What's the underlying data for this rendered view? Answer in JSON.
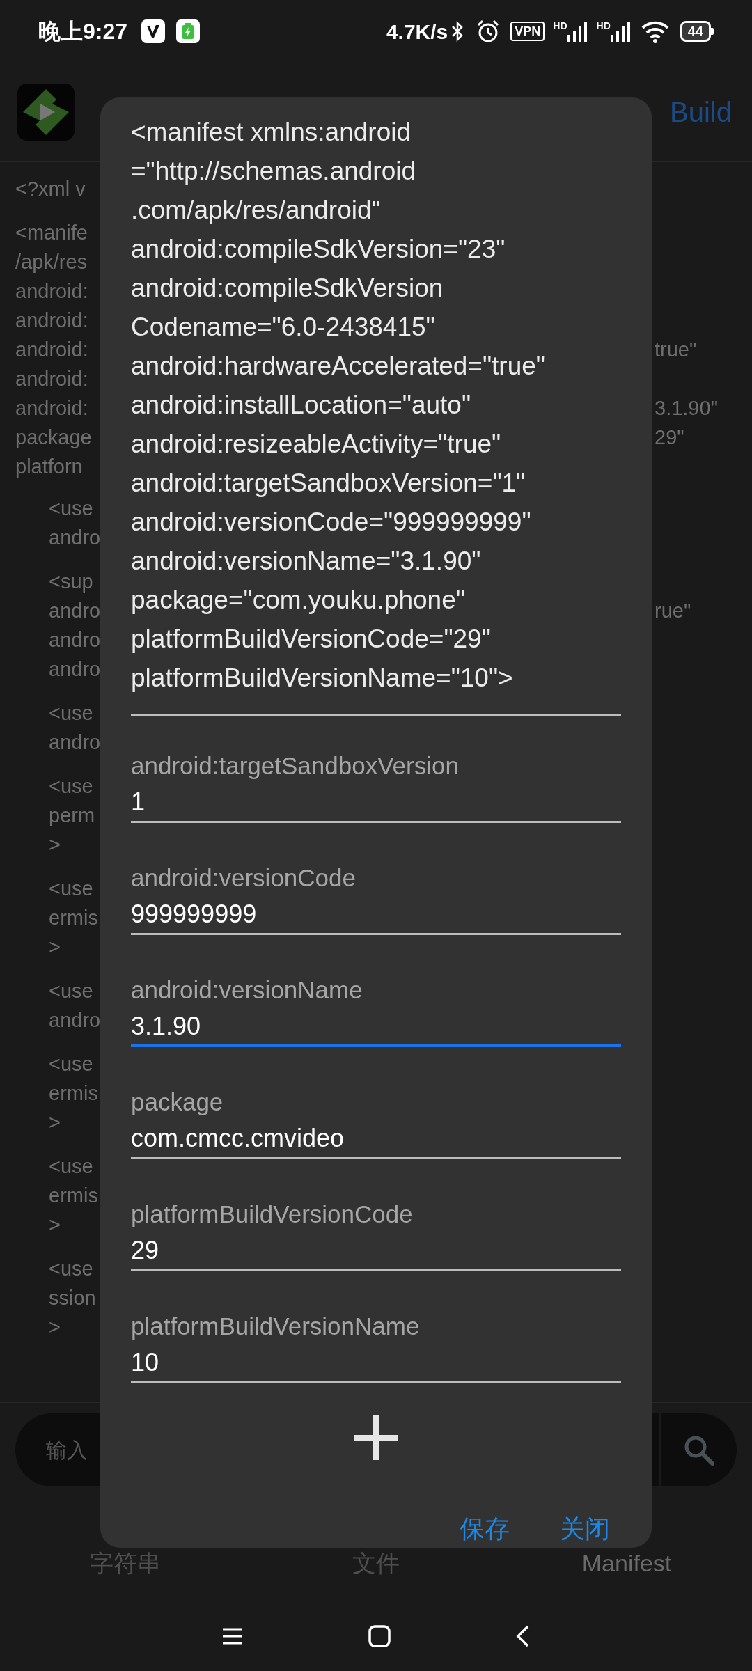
{
  "status_bar": {
    "time": "晚上9:27",
    "net_speed": "4.7K/s",
    "vpn": "VPN",
    "signal_badges": [
      "HD",
      "HD"
    ],
    "battery": "44"
  },
  "app_header": {
    "action": "Build"
  },
  "code": [
    {
      "lines": [
        {
          "text": "<?xml v"
        }
      ]
    },
    {
      "lines": [
        {
          "text": "<manife"
        },
        {
          "text": "/apk/res"
        },
        {
          "text": "android:"
        },
        {
          "text": "android:"
        },
        {
          "text": "android:",
          "tail": "true\""
        },
        {
          "text": "android:"
        },
        {
          "text": "android:",
          "tail": "3.1.90\""
        },
        {
          "text": "package",
          "tail": "29\""
        },
        {
          "text": "platforn"
        }
      ],
      "children": [
        {
          "lines": [
            {
              "text": "<use"
            },
            {
              "text": "andro"
            }
          ]
        },
        {
          "lines": [
            {
              "text": "<sup"
            },
            {
              "text": "andro",
              "tail": "rue\""
            },
            {
              "text": "andro"
            },
            {
              "text": "andro"
            }
          ]
        },
        {
          "lines": [
            {
              "text": "<use"
            },
            {
              "text": "andro"
            }
          ]
        },
        {
          "lines": [
            {
              "text": "<use"
            },
            {
              "text": "perm"
            },
            {
              "text": ">"
            }
          ]
        },
        {
          "lines": [
            {
              "text": "<use"
            },
            {
              "text": "ermis"
            },
            {
              "text": ">"
            }
          ]
        },
        {
          "lines": [
            {
              "text": "<use"
            },
            {
              "text": "andro"
            }
          ]
        },
        {
          "lines": [
            {
              "text": "<use"
            },
            {
              "text": "ermis"
            },
            {
              "text": ">"
            }
          ]
        },
        {
          "lines": [
            {
              "text": "<use"
            },
            {
              "text": "ermis"
            },
            {
              "text": ">"
            }
          ]
        },
        {
          "lines": [
            {
              "text": "<use"
            },
            {
              "text": "ssion"
            },
            {
              "text": ">"
            }
          ]
        }
      ]
    }
  ],
  "search": {
    "placeholder": "输入"
  },
  "bottom_tabs": [
    {
      "label": "字符串",
      "selected": false
    },
    {
      "label": "文件",
      "selected": false
    },
    {
      "label": "Manifest",
      "selected": true
    }
  ],
  "dialog": {
    "manifest_lines": [
      "<manifest xmlns:android",
      "=\"http://schemas.android",
      ".com/apk/res/android\"",
      "android:compileSdkVersion=\"23\"",
      "android:compileSdkVersion",
      "Codename=\"6.0-2438415\"",
      "android:hardwareAccelerated=\"true\"",
      "android:installLocation=\"auto\"",
      "android:resizeableActivity=\"true\"",
      "android:targetSandboxVersion=\"1\"",
      "android:versionCode=\"999999999\"",
      "android:versionName=\"3.1.90\"",
      "package=\"com.youku.phone\"",
      "platformBuildVersionCode=\"29\"",
      "platformBuildVersionName=\"10\">"
    ],
    "fields": [
      {
        "label": "android:targetSandboxVersion",
        "value": "1",
        "focused": false
      },
      {
        "label": "android:versionCode",
        "value": "999999999",
        "focused": false
      },
      {
        "label": "android:versionName",
        "value": "3.1.90",
        "focused": true
      },
      {
        "label": "package",
        "value": "com.cmcc.cmvideo",
        "focused": false
      },
      {
        "label": "platformBuildVersionCode",
        "value": "29",
        "focused": false
      },
      {
        "label": "platformBuildVersionName",
        "value": "10",
        "focused": false
      }
    ],
    "buttons": [
      "保存",
      "关闭"
    ]
  }
}
